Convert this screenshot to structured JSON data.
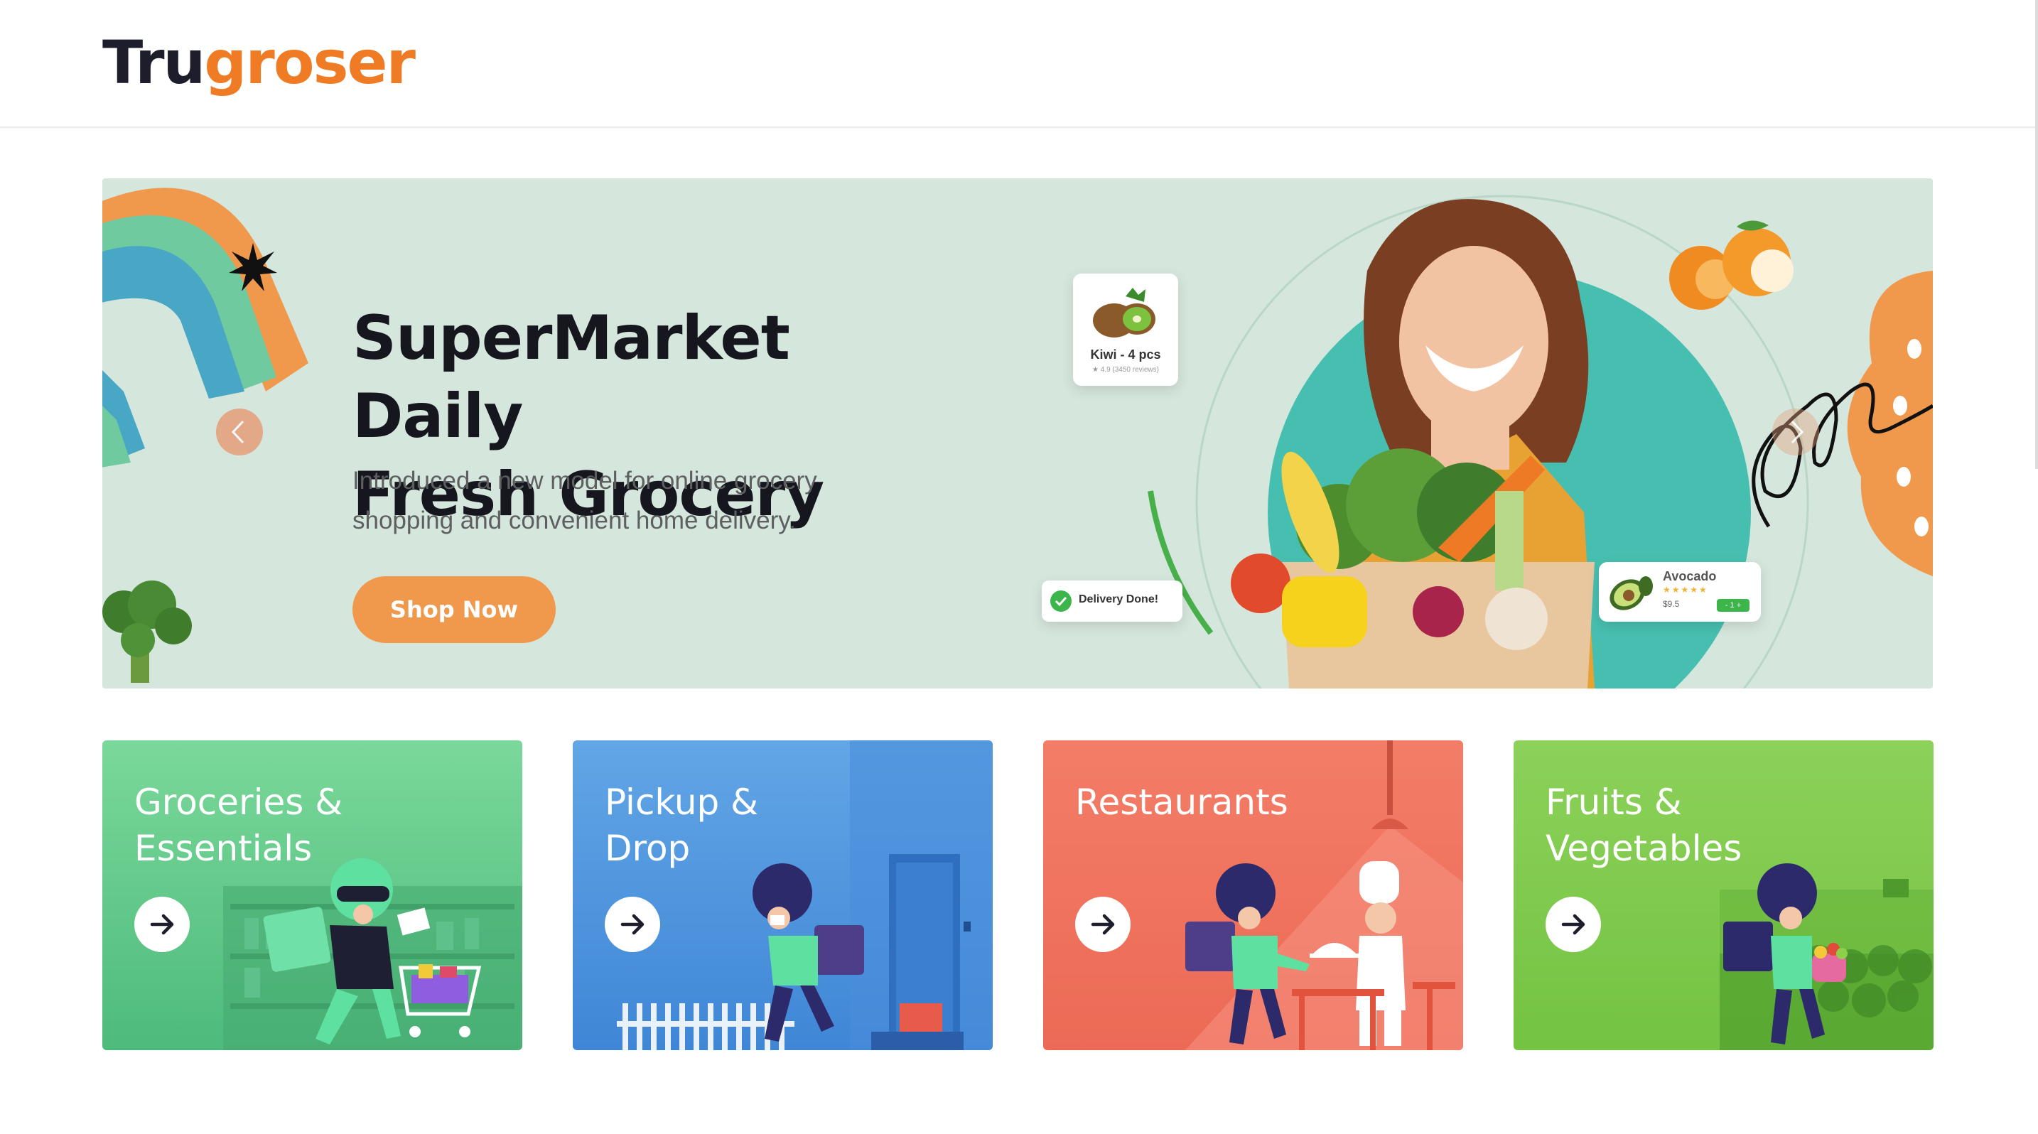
{
  "brand": {
    "part1": "Tru",
    "part2": "groser"
  },
  "hero": {
    "title_line1": "SuperMarket Daily",
    "title_line2": "Fresh Grocery",
    "subtitle_line1": "Introduced a new model for online grocery",
    "subtitle_line2": "shopping and convenient home delivery.",
    "cta_label": "Shop Now",
    "kiwi_card": {
      "label": "Kiwi - 4 pcs",
      "reviews": "★ 4.9  (3450 reviews)"
    },
    "delivery_card": {
      "label": "Delivery Done!"
    },
    "avocado_card": {
      "label": "Avocado",
      "price": "$9.5",
      "stars": "★★★★★",
      "qty": "- 1 +"
    }
  },
  "categories": [
    {
      "line1": "Groceries &",
      "line2": "Essentials"
    },
    {
      "line1": "Pickup &",
      "line2": "Drop"
    },
    {
      "line1": "Restaurants",
      "line2": ""
    },
    {
      "line1": "Fruits &",
      "line2": "Vegetables"
    }
  ],
  "icons": {
    "prev": "chevron-left-icon",
    "next": "chevron-right-icon",
    "tile_arrow": "arrow-right-icon",
    "check": "check-icon"
  },
  "colors": {
    "brand_dark": "#1d1d2b",
    "brand_orange": "#ef7b24",
    "hero_bg": "#d5e6dc",
    "cta": "#f0984b",
    "tile_groceries": "#5cc885",
    "tile_pickup": "#4f96de",
    "tile_restaurants": "#ef725d",
    "tile_fruits": "#80ca4e"
  }
}
